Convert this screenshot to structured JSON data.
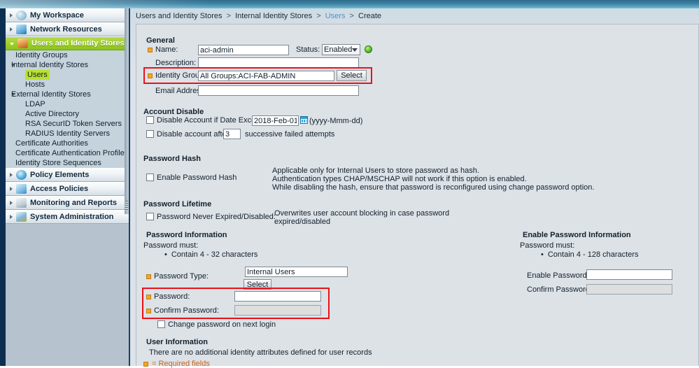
{
  "breadcrumb": {
    "items": [
      "Users and Identity Stores",
      "Internal Identity Stores",
      "Users",
      "Create"
    ],
    "separator": ">"
  },
  "sidebar": {
    "top_items": [
      {
        "label": "My Workspace",
        "icon": "workspace-icon",
        "expanded": false,
        "active": false
      },
      {
        "label": "Network Resources",
        "icon": "network-icon",
        "expanded": false,
        "active": false
      },
      {
        "label": "Users and Identity Stores",
        "icon": "users-icon",
        "expanded": true,
        "active": true
      }
    ],
    "sub_items": [
      {
        "label": "Identity Groups",
        "indent": 1,
        "caret": false,
        "highlight": false
      },
      {
        "label": "Internal Identity Stores",
        "indent": 0,
        "caret": true,
        "highlight": false
      },
      {
        "label": "Users",
        "indent": 2,
        "caret": false,
        "highlight": true
      },
      {
        "label": "Hosts",
        "indent": 2,
        "caret": false,
        "highlight": false
      },
      {
        "label": "External Identity Stores",
        "indent": 0,
        "caret": true,
        "highlight": false
      },
      {
        "label": "LDAP",
        "indent": 2,
        "caret": false,
        "highlight": false
      },
      {
        "label": "Active Directory",
        "indent": 2,
        "caret": false,
        "highlight": false
      },
      {
        "label": "RSA SecurID Token Servers",
        "indent": 2,
        "caret": false,
        "highlight": false
      },
      {
        "label": "RADIUS Identity Servers",
        "indent": 2,
        "caret": false,
        "highlight": false
      },
      {
        "label": "Certificate Authorities",
        "indent": 1,
        "caret": false,
        "highlight": false
      },
      {
        "label": "Certificate Authentication Profile",
        "indent": 1,
        "caret": false,
        "highlight": false
      },
      {
        "label": "Identity Store Sequences",
        "indent": 1,
        "caret": false,
        "highlight": false
      }
    ],
    "bottom_items": [
      {
        "label": "Policy Elements",
        "icon": "policy-icon"
      },
      {
        "label": "Access Policies",
        "icon": "access-icon"
      },
      {
        "label": "Monitoring and Reports",
        "icon": "monitor-icon"
      },
      {
        "label": "System Administration",
        "icon": "system-icon"
      }
    ]
  },
  "form": {
    "general": {
      "title": "General",
      "name_label": "Name:",
      "name_value": "aci-admin",
      "status_label": "Status:",
      "status_value": "Enabled",
      "status_badge": "enabled-green-dot",
      "description_label": "Description:",
      "description_value": "",
      "identity_group_label": "Identity Group:",
      "identity_group_value": "All Groups:ACI-FAB-ADMIN",
      "identity_group_select": "Select",
      "email_label": "Email Address:",
      "email_value": ""
    },
    "account_disable": {
      "title": "Account Disable",
      "date_checkbox_label": "Disable Account if Date Exceeds:",
      "date_value": "2018-Feb-01",
      "date_format_hint": "(yyyy-Mmm-dd)",
      "attempts_label_pre": "Disable account after",
      "attempts_value": "3",
      "attempts_label_post": "successive failed attempts"
    },
    "password_hash": {
      "title": "Password Hash",
      "checkbox_label": "Enable Password Hash",
      "hint_lines": [
        "Applicable only for Internal Users to store password as hash.",
        "Authentication types CHAP/MSCHAP will not work if this option is enabled.",
        "While disabling the hash, ensure that password is reconfigured using change password option."
      ]
    },
    "password_lifetime": {
      "title": "Password Lifetime",
      "checkbox_label": "Password Never Expired/Disabled:",
      "hint_lines": [
        "Overwrites user account blocking in case password",
        "expired/disabled"
      ]
    },
    "password_information": {
      "title": "Password Information",
      "must_label": "Password must:",
      "rules": [
        "Contain 4 - 32 characters"
      ],
      "password_type_label": "Password Type:",
      "password_type_value": "Internal Users",
      "password_type_select": "Select",
      "password_label": "Password:",
      "password_value": "",
      "confirm_label": "Confirm Password:",
      "confirm_value": "",
      "change_next_login_label": "Change password on next login"
    },
    "enable_password_information": {
      "title": "Enable Password Information",
      "must_label": "Password must:",
      "rules": [
        "Contain 4 - 128 characters"
      ],
      "enable_password_label": "Enable Password:",
      "enable_password_value": "",
      "confirm_label": "Confirm Password:",
      "confirm_value": ""
    },
    "user_information": {
      "title": "User Information",
      "note": "There are no additional identity attributes defined for user records"
    },
    "required_note": "= Required fields"
  },
  "colors": {
    "accent_green": "#9ecf2c",
    "highlight_green": "#b9e030",
    "required_orange": "#f5a623",
    "required_text": "#c8621d",
    "link_blue": "#4f93c8",
    "redbox": "#e8121a"
  }
}
